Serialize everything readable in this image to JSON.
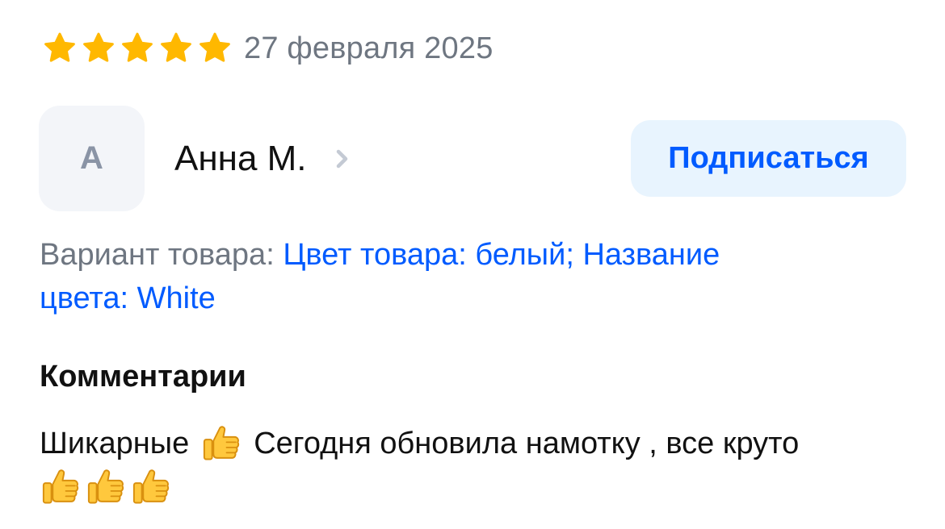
{
  "review": {
    "rating": 5,
    "rating_max": 5,
    "date": "27 февраля 2025",
    "star_color": "#ffb800"
  },
  "author": {
    "initial": "А",
    "name": "Анна М.",
    "subscribe_label": "Подписаться"
  },
  "variant": {
    "label": "Вариант товара: ",
    "value_line1": "Цвет товара: белый; Название",
    "value_line2": "цвета: White"
  },
  "comments": {
    "title": "Комментарии",
    "text_part1": "Шикарные",
    "text_part2": "Сегодня обновила намотку , все круто",
    "emoji_icon": "thumbs-up-icon"
  },
  "colors": {
    "accent": "#005bff",
    "muted_text": "#6e7681",
    "button_bg": "#e8f4fe"
  }
}
